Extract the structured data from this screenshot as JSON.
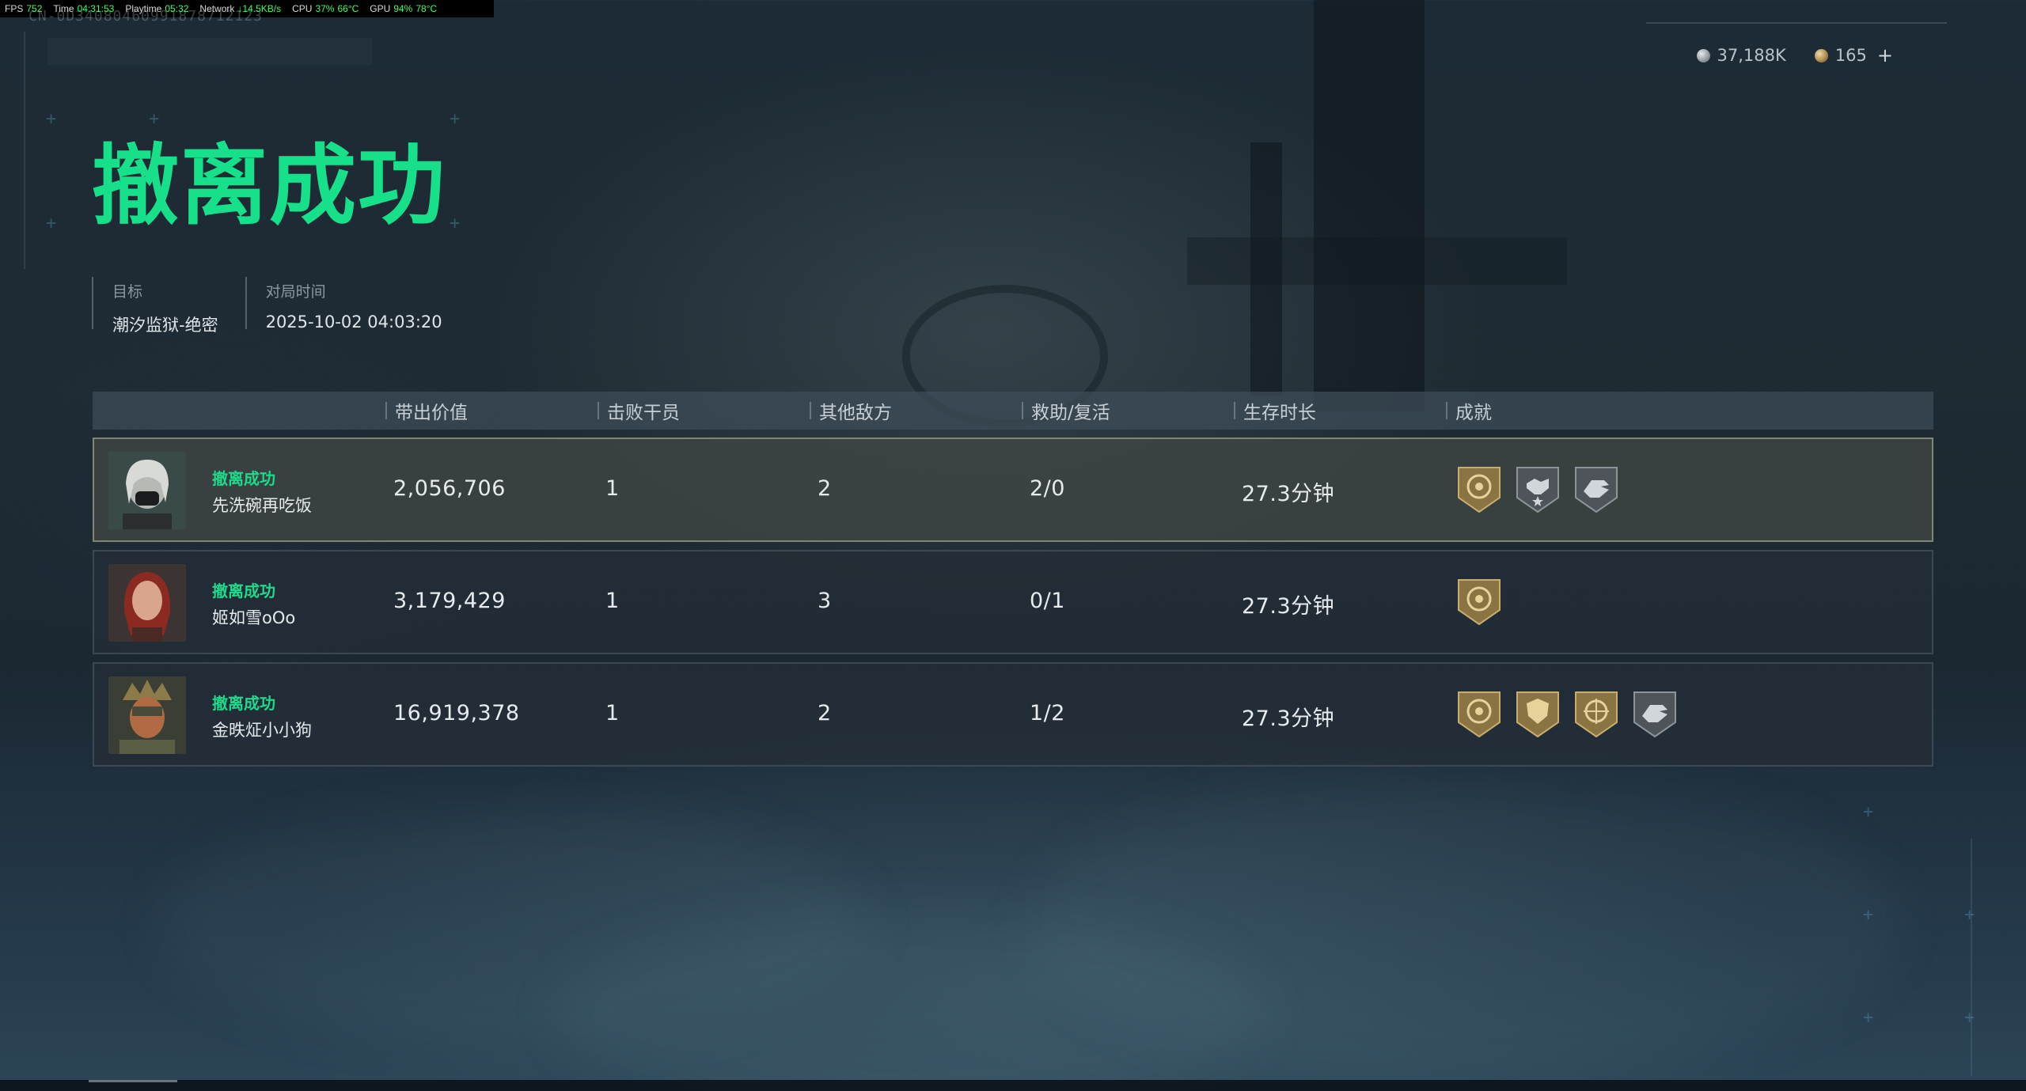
{
  "perf": {
    "fps_label": "FPS",
    "fps": "752",
    "time_label": "Time",
    "time": "04:31:53",
    "playtime_label": "Playtime",
    "playtime": "05:32",
    "network_label": "Network",
    "network": "↓14.5KB/s",
    "cpu_label": "CPU",
    "cpu": "37%",
    "cpu_temp": "66°C",
    "gpu_label": "GPU",
    "gpu": "94%",
    "gpu_temp": "78°C"
  },
  "player_id_text": "CN-0D34080460991878712123",
  "currency": {
    "silver": "37,188K",
    "gold": "165",
    "add_label": "+"
  },
  "title": "撤离成功",
  "meta": {
    "target_label": "目标",
    "target_value": "潮汐监狱-绝密",
    "time_label": "对局时间",
    "time_value": "2025-10-02 04:03:20"
  },
  "table": {
    "headers": [
      "带出价值",
      "击败干员",
      "其他敌方",
      "救助/复活",
      "生存时长",
      "成就"
    ],
    "rows": [
      {
        "status": "撤离成功",
        "name": "先洗碗再吃饭",
        "value": "2,056,706",
        "kills": "1",
        "other": "2",
        "assist": "2/0",
        "survival": "27.3分钟",
        "achievements": [
          "extract-gold",
          "handshake-silver",
          "hand-silver"
        ]
      },
      {
        "status": "撤离成功",
        "name": "姬如雪oOo",
        "value": "3,179,429",
        "kills": "1",
        "other": "3",
        "assist": "0/1",
        "survival": "27.3分钟",
        "achievements": [
          "extract-gold"
        ]
      },
      {
        "status": "撤离成功",
        "name": "金昳炡小小狗",
        "value": "16,919,378",
        "kills": "1",
        "other": "2",
        "assist": "1/2",
        "survival": "27.3分钟",
        "achievements": [
          "extract-gold",
          "shield-gold",
          "target-gold",
          "hand-silver"
        ]
      }
    ]
  },
  "colors": {
    "accent_green": "#16e08a",
    "badge_gold": "#b89a5c",
    "badge_silver": "#9aa3a8"
  }
}
